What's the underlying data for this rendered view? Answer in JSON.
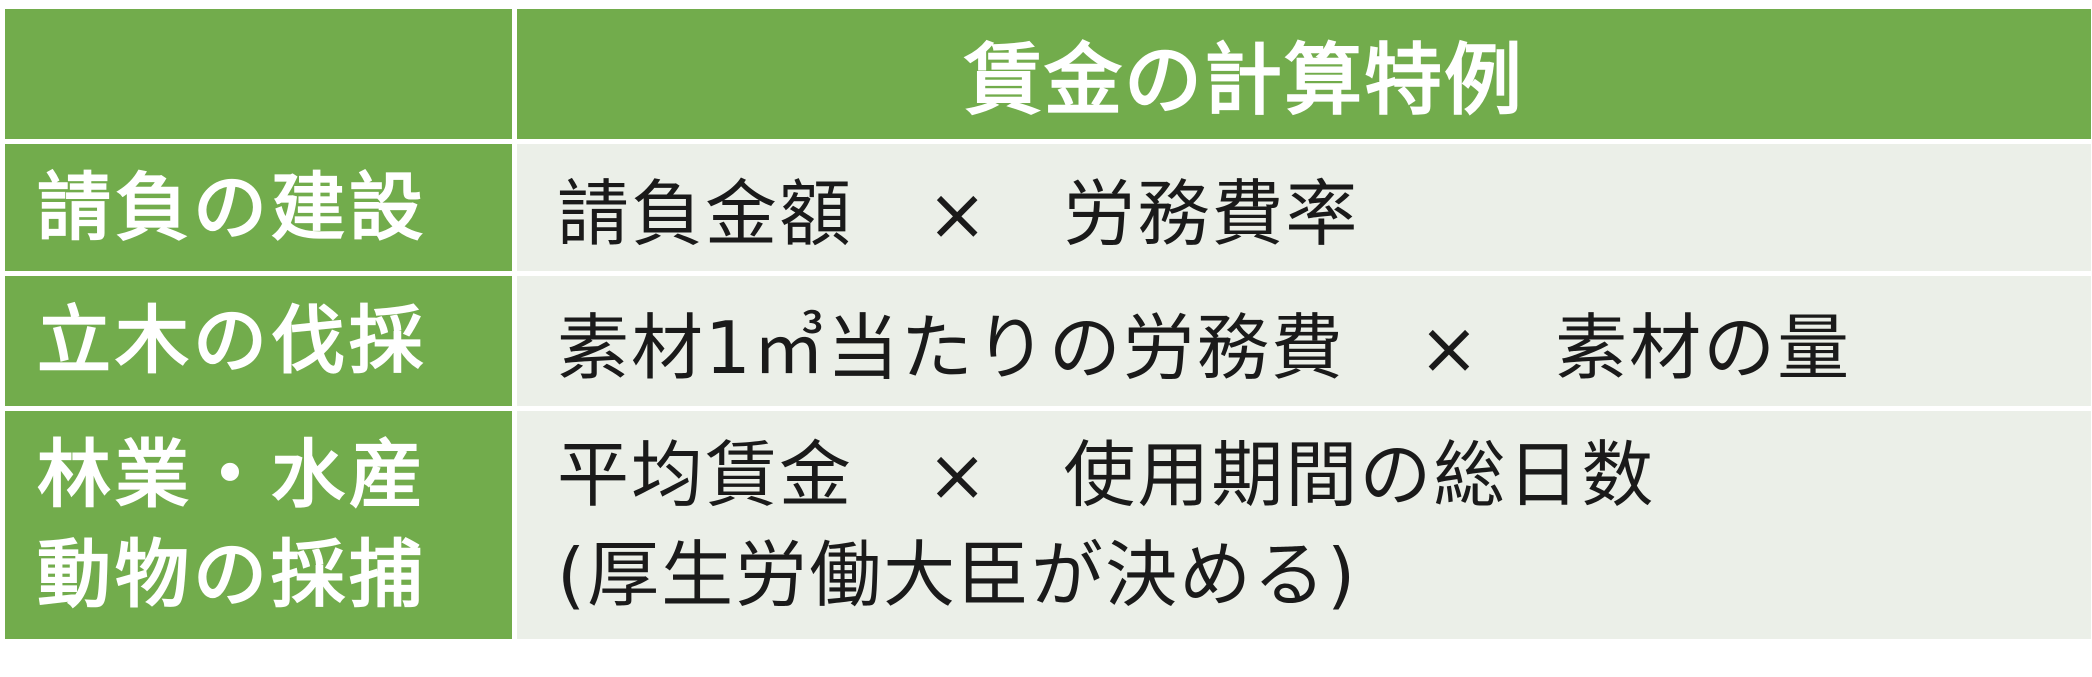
{
  "header": {
    "title": "賃金の計算特例"
  },
  "rows": [
    {
      "label": "請負の建設",
      "value": "請負金額　×　労務費率"
    },
    {
      "label": "立木の伐採",
      "value": "素材1㎥当たりの労務費　×　素材の量"
    },
    {
      "label_lines": [
        "林業・水産",
        "動物の採捕"
      ],
      "value_lines": [
        "平均賃金　×　使用期間の総日数",
        "(厚生労働大臣が決める)"
      ]
    }
  ],
  "colors": {
    "header_bg": "#72ac4c",
    "label_bg": "#72ac4c",
    "value_bg": "#ebefe8"
  }
}
